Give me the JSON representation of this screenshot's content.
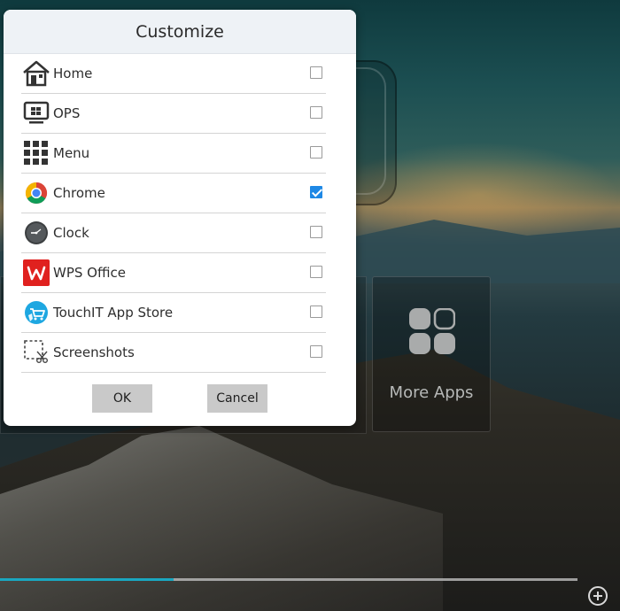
{
  "dialog": {
    "title": "Customize",
    "items": [
      {
        "label": "Home",
        "icon": "home-icon",
        "checked": false
      },
      {
        "label": "OPS",
        "icon": "ops-icon",
        "checked": false
      },
      {
        "label": "Menu",
        "icon": "grid-menu-icon",
        "checked": false
      },
      {
        "label": "Chrome",
        "icon": "chrome-icon",
        "checked": true
      },
      {
        "label": "Clock",
        "icon": "clock-icon",
        "checked": false
      },
      {
        "label": "WPS Office",
        "icon": "wps-office-icon",
        "checked": false
      },
      {
        "label": "TouchIT App Store",
        "icon": "app-store-icon",
        "checked": false
      },
      {
        "label": "Screenshots",
        "icon": "screenshot-icon",
        "checked": false
      }
    ],
    "ok_label": "OK",
    "cancel_label": "Cancel"
  },
  "background": {
    "more_apps_label": "More Apps",
    "progress": 0.3,
    "colors": {
      "accent": "#1e88e5",
      "progress": "#1aa7c0",
      "button": "#c9c9c9",
      "wps_red": "#e0211f"
    }
  }
}
